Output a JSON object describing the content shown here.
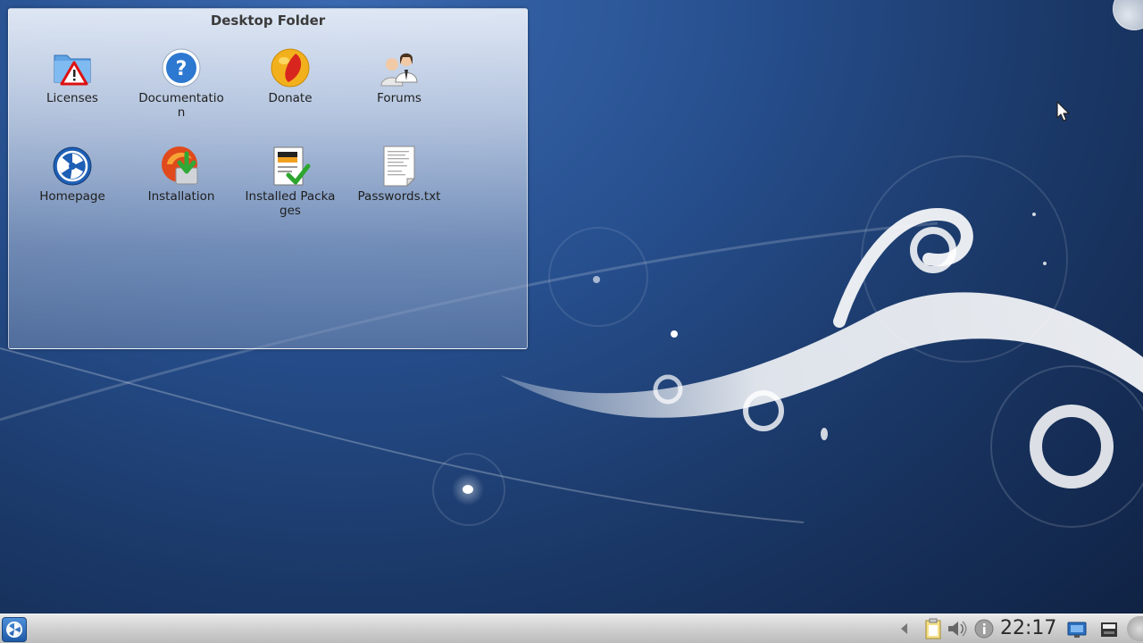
{
  "folder": {
    "title": "Desktop Folder",
    "icons": [
      {
        "label": "Licenses",
        "icon": "folder-warning-icon"
      },
      {
        "label": "Documentatio n",
        "icon": "help-icon"
      },
      {
        "label": "Donate",
        "icon": "donate-icon"
      },
      {
        "label": "Forums",
        "icon": "users-icon"
      },
      {
        "label": "Homepage",
        "icon": "homepage-icon"
      },
      {
        "label": "Installation",
        "icon": "install-icon"
      },
      {
        "label": "Installed Packages",
        "icon": "packages-icon"
      },
      {
        "label": "Passwords.txt",
        "icon": "text-file-icon"
      }
    ]
  },
  "taskbar": {
    "clock": "22:17",
    "tray_icons": [
      "hide-arrow-icon",
      "clipboard-icon",
      "volume-icon",
      "info-icon",
      "network-icon",
      "device-notifier-icon"
    ]
  },
  "colors": {
    "accent": "#1e5aa8",
    "desktop_bg": "#1a3766"
  }
}
